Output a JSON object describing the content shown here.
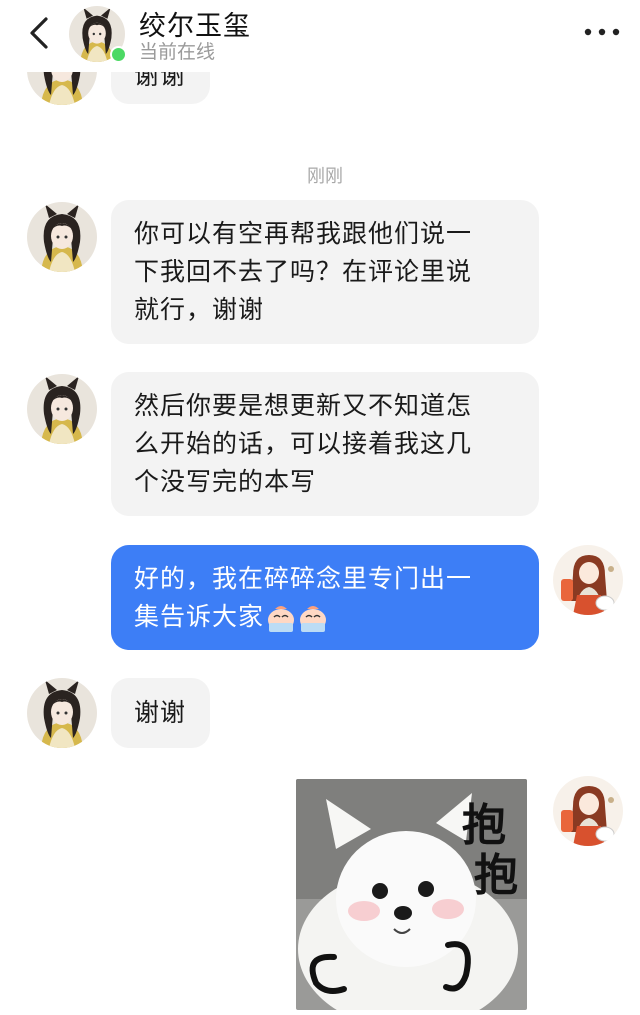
{
  "header": {
    "contact_name": "绞尔玉玺",
    "status": "当前在线"
  },
  "chat": {
    "timestamp": "刚刚",
    "messages": [
      {
        "from": "contact",
        "lines": [
          "谢谢"
        ]
      },
      {
        "from": "contact",
        "lines": [
          "你可以有空再帮我跟他们说一",
          "下我回不去了吗？在评论里说",
          "就行，谢谢"
        ]
      },
      {
        "from": "contact",
        "lines": [
          "然后你要是想更新又不知道怎",
          "么开始的话，可以接着我这几",
          "个没写完的本写"
        ]
      },
      {
        "from": "me",
        "lines": [
          "好的，我在碎碎念里专门出一",
          "集告诉大家"
        ],
        "emojis": [
          "crying-emoji",
          "crying-emoji"
        ]
      },
      {
        "from": "contact",
        "lines": [
          "谢谢"
        ]
      },
      {
        "from": "me",
        "type": "sticker",
        "sticker_text": [
          "抱",
          "抱"
        ]
      }
    ]
  },
  "colors": {
    "outgoing_bubble": "#3d7ef6",
    "incoming_bubble": "#f3f3f3",
    "online_dot": "#4cd964"
  }
}
